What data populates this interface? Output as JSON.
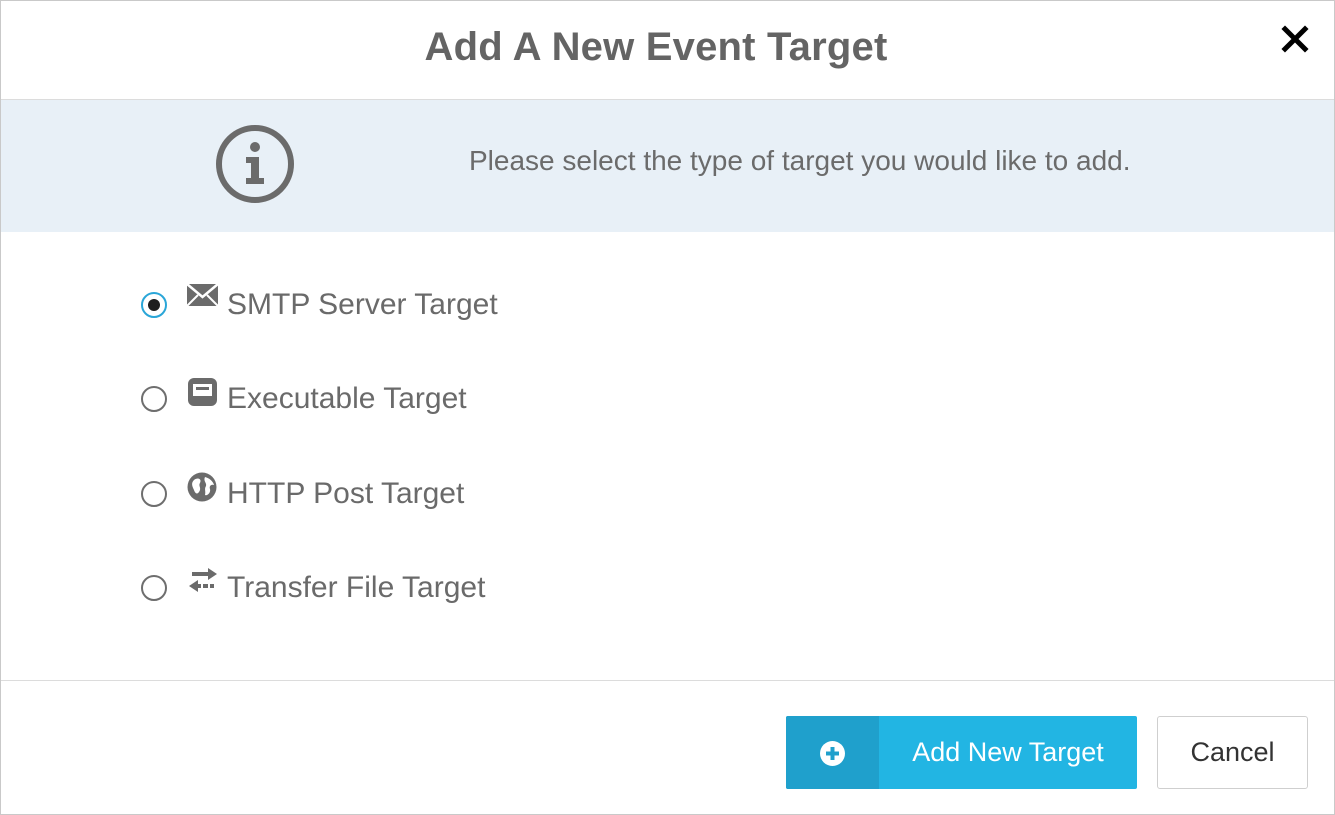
{
  "dialog": {
    "title": "Add A New Event Target",
    "close_icon": "close-icon"
  },
  "info": {
    "icon": "info-icon",
    "message": "Please select the type of target you would like to add."
  },
  "options": [
    {
      "label": "SMTP Server Target",
      "icon": "envelope-icon",
      "selected": true
    },
    {
      "label": "Executable Target",
      "icon": "window-icon",
      "selected": false
    },
    {
      "label": "HTTP Post Target",
      "icon": "globe-icon",
      "selected": false
    },
    {
      "label": "Transfer File Target",
      "icon": "transfer-arrows-icon",
      "selected": false
    }
  ],
  "footer": {
    "add_button_label": "Add New Target",
    "add_button_icon": "plus-circle-icon",
    "cancel_button_label": "Cancel"
  },
  "colors": {
    "accent": "#22b5e3",
    "accent_dark": "#1fa0cc",
    "banner_bg": "#e8f0f7",
    "radio_selected_ring": "#2aa6d8",
    "text": "#676767"
  }
}
